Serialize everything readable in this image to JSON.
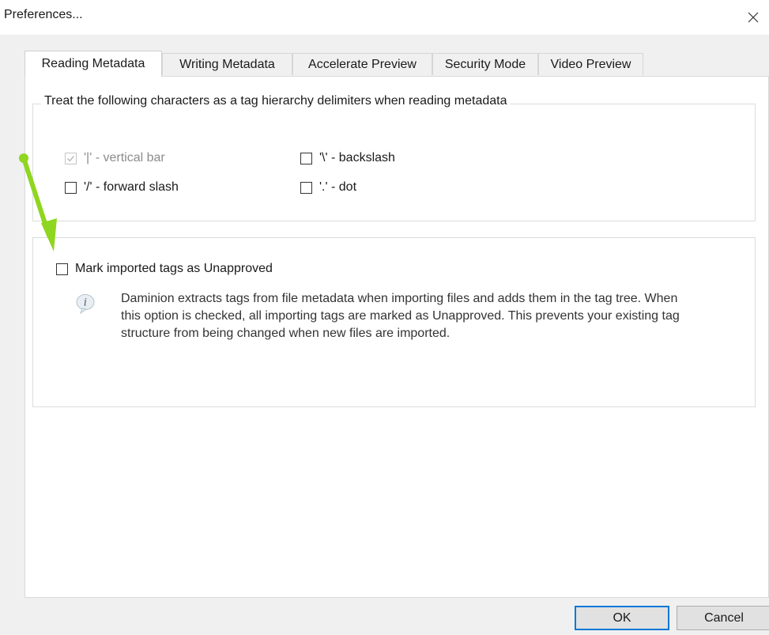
{
  "window": {
    "title": "Preferences...",
    "close_icon": "close-icon"
  },
  "tabs": [
    {
      "label": "Reading Metadata",
      "active": true
    },
    {
      "label": "Writing Metadata",
      "active": false
    },
    {
      "label": "Accelerate Preview",
      "active": false
    },
    {
      "label": "Security Mode",
      "active": false
    },
    {
      "label": "Video Preview",
      "active": false
    }
  ],
  "delimiters": {
    "caption": "Treat the following characters as a tag hierarchy delimiters when reading metadata",
    "options": [
      {
        "label": "'|' - vertical bar",
        "checked": true,
        "enabled": false
      },
      {
        "label": "'\\' - backslash",
        "checked": false,
        "enabled": true
      },
      {
        "label": "'/' - forward slash",
        "checked": false,
        "enabled": true
      },
      {
        "label": "'.' - dot",
        "checked": false,
        "enabled": true
      }
    ]
  },
  "unapproved": {
    "label": "Mark imported tags as Unapproved",
    "checked": false,
    "info_icon": "info-icon",
    "description": "Daminion extracts tags from file metadata when importing files and adds them in the tag tree. When this option is checked, all importing tags are marked as Unapproved. This prevents your existing tag structure from being changed when new files are imported."
  },
  "buttons": {
    "ok": "OK",
    "cancel": "Cancel"
  },
  "annotation": {
    "arrow_color": "#8ed61f"
  }
}
